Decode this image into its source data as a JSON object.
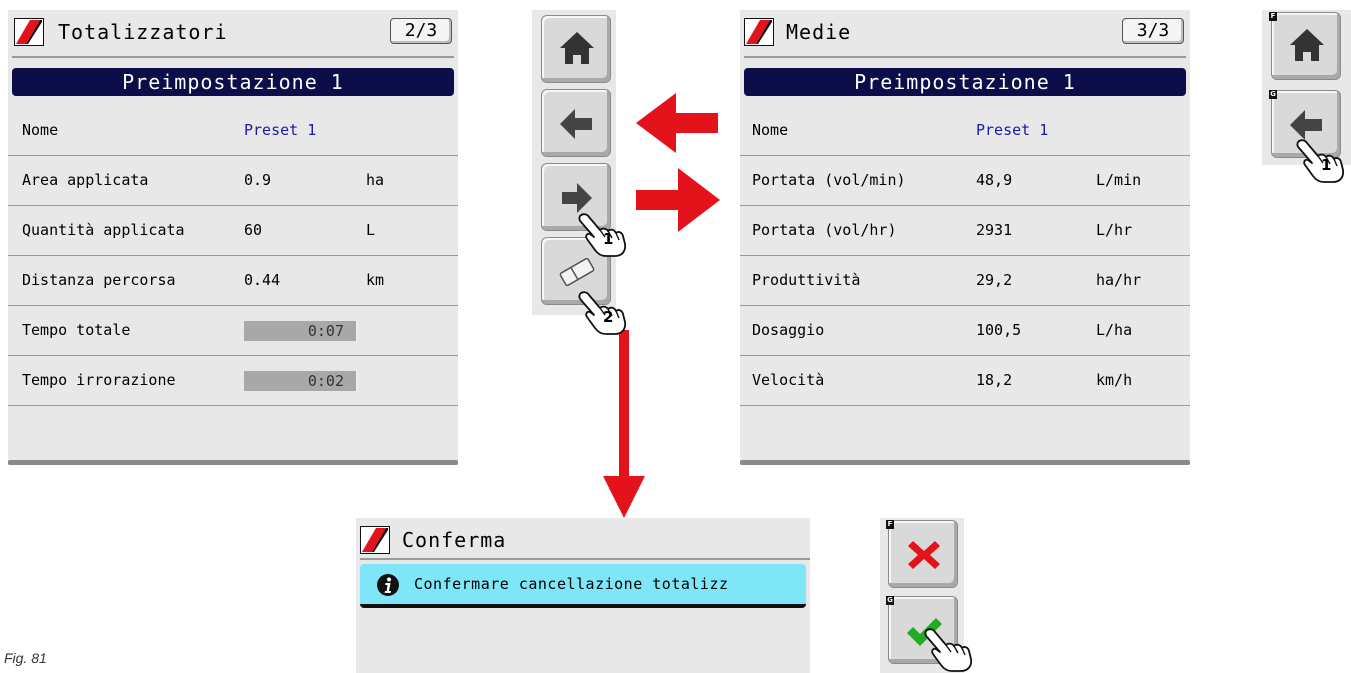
{
  "screen1": {
    "title": "Totalizzatori",
    "page": "2/3",
    "banner": "Preimpostazione 1",
    "rows": [
      {
        "label": "Nome",
        "value": "Preset 1",
        "unit": ""
      },
      {
        "label": "Area applicata",
        "value": "0.9",
        "unit": "ha"
      },
      {
        "label": "Quantità applicata",
        "value": "60",
        "unit": "L"
      },
      {
        "label": "Distanza percorsa",
        "value": "0.44",
        "unit": "km"
      },
      {
        "label": "Tempo totale",
        "value": "0:07",
        "unit": ""
      },
      {
        "label": "Tempo irrorazione",
        "value": "0:02",
        "unit": ""
      }
    ]
  },
  "screen2": {
    "title": "Medie",
    "page": "3/3",
    "banner": "Preimpostazione 1",
    "rows": [
      {
        "label": "Nome",
        "value": "Preset 1",
        "unit": ""
      },
      {
        "label": "Portata (vol/min)",
        "value": "48,9",
        "unit": "L/min"
      },
      {
        "label": "Portata (vol/hr)",
        "value": "2931",
        "unit": "L/hr"
      },
      {
        "label": "Produttività",
        "value": "29,2",
        "unit": "ha/hr"
      },
      {
        "label": "Dosaggio",
        "value": "100,5",
        "unit": "L/ha"
      },
      {
        "label": "Velocità",
        "value": "18,2",
        "unit": "km/h"
      }
    ]
  },
  "screen3": {
    "title": "Conferma",
    "message": "Confermare cancellazione totalizz"
  },
  "keys": {
    "f_letter": "F",
    "g_letter": "G"
  },
  "callouts": {
    "one": "1",
    "two": "2"
  },
  "icons": {
    "home": "home-icon",
    "back": "arrow-left-icon",
    "forward": "arrow-right-icon",
    "erase": "eraser-icon",
    "cancel": "cross-icon",
    "confirm": "checkmark-icon",
    "info": "info-icon",
    "logo": "brand-logo"
  },
  "colors": {
    "banner": "#0d0d4a",
    "value_blue": "#1a1aa8",
    "flow_arrow": "#e3121b",
    "info_bar": "#7fe6f7",
    "cancel_red": "#e3121b",
    "confirm_green": "#22aa22"
  },
  "caption": "Fig. 81"
}
